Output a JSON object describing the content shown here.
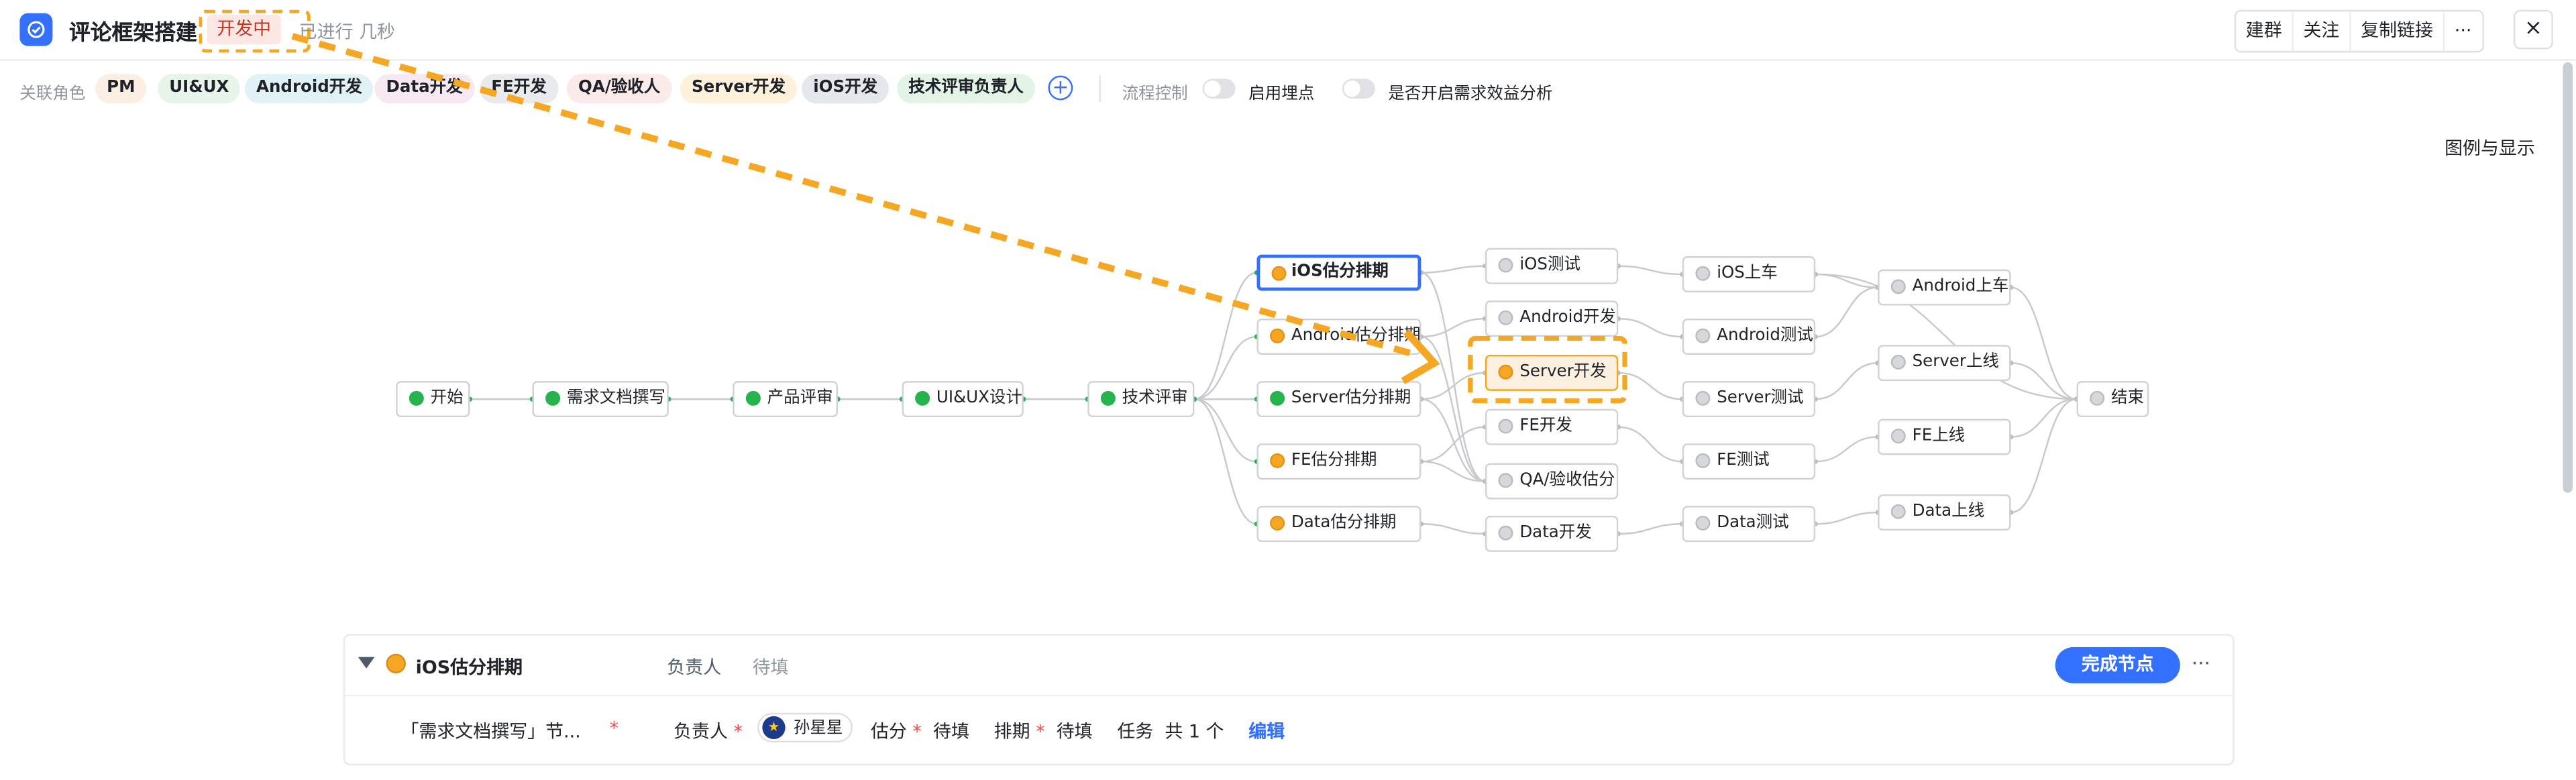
{
  "header": {
    "title": "评论框架搭建",
    "status": "开发中",
    "elapsed": "已进行 几秒",
    "actions": [
      "建群",
      "关注",
      "复制链接",
      "···"
    ],
    "close": "×"
  },
  "roles_bar": {
    "label": "关联角色",
    "roles": [
      {
        "label": "PM",
        "bg": "#fbeee2",
        "fg": "#1f2329"
      },
      {
        "label": "UI&UX",
        "bg": "#e6f4ea",
        "fg": "#1f2329"
      },
      {
        "label": "Android开发",
        "bg": "#e1f2f7",
        "fg": "#1f2329"
      },
      {
        "label": "Data开发",
        "bg": "#f6e9f2",
        "fg": "#1f2329"
      },
      {
        "label": "FE开发",
        "bg": "#e9eaec",
        "fg": "#1f2329"
      },
      {
        "label": "QA/验收人",
        "bg": "#fbeaea",
        "fg": "#1f2329"
      },
      {
        "label": "Server开发",
        "bg": "#fdf1dc",
        "fg": "#1f2329"
      },
      {
        "label": "iOS开发",
        "bg": "#e4e7eb",
        "fg": "#1f2329"
      },
      {
        "label": "技术评审负责人",
        "bg": "#e3f3e6",
        "fg": "#1f2329"
      }
    ],
    "add": "+",
    "flow_control": "流程控制",
    "toggle_tracking": "启用埋点",
    "toggle_benefit": "是否开启需求效益分析"
  },
  "legend_link": "图例与显示",
  "graph": {
    "nodes": [
      {
        "id": "start",
        "label": "开始",
        "status": "green"
      },
      {
        "id": "prd",
        "label": "需求文档撰写",
        "status": "green"
      },
      {
        "id": "review",
        "label": "产品评审",
        "status": "green"
      },
      {
        "id": "design",
        "label": "UI&UX设计",
        "status": "green"
      },
      {
        "id": "tech",
        "label": "技术评审",
        "status": "green"
      },
      {
        "id": "ios_est",
        "label": "iOS估分排期",
        "status": "orange"
      },
      {
        "id": "android_est",
        "label": "Android估分排期",
        "status": "orange"
      },
      {
        "id": "server_est",
        "label": "Server估分排期",
        "status": "green"
      },
      {
        "id": "fe_est",
        "label": "FE估分排期",
        "status": "orange"
      },
      {
        "id": "data_est",
        "label": "Data估分排期",
        "status": "orange"
      },
      {
        "id": "ios_test",
        "label": "iOS测试",
        "status": "gray"
      },
      {
        "id": "android_dev",
        "label": "Android开发",
        "status": "gray"
      },
      {
        "id": "server_dev",
        "label": "Server开发",
        "status": "orange"
      },
      {
        "id": "fe_dev",
        "label": "FE开发",
        "status": "gray"
      },
      {
        "id": "qa_est",
        "label": "QA/验收估分",
        "status": "gray"
      },
      {
        "id": "data_dev",
        "label": "Data开发",
        "status": "gray"
      },
      {
        "id": "ios_launch",
        "label": "iOS上车",
        "status": "gray"
      },
      {
        "id": "android_test",
        "label": "Android测试",
        "status": "gray"
      },
      {
        "id": "server_test",
        "label": "Server测试",
        "status": "gray"
      },
      {
        "id": "fe_test",
        "label": "FE测试",
        "status": "gray"
      },
      {
        "id": "data_test",
        "label": "Data测试",
        "status": "gray"
      },
      {
        "id": "android_launch",
        "label": "Android上车",
        "status": "gray"
      },
      {
        "id": "server_launch",
        "label": "Server上线",
        "status": "gray"
      },
      {
        "id": "fe_launch",
        "label": "FE上线",
        "status": "gray"
      },
      {
        "id": "data_launch",
        "label": "Data上线",
        "status": "gray"
      },
      {
        "id": "end",
        "label": "结束",
        "status": "gray"
      }
    ]
  },
  "panel": {
    "node_title": "iOS估分排期",
    "owner_label": "负责人",
    "owner_value": "待填",
    "complete_button": "完成节点",
    "more": "···",
    "dependency": "「需求文档撰写」节...",
    "required_mark": "*",
    "owner_field": "负责人",
    "assignee": "孙星星",
    "estimate_label": "估分",
    "estimate_value": "待填",
    "schedule_label": "排期",
    "schedule_value": "待填",
    "task_label": "任务",
    "task_count": "共 1 个",
    "edit": "编辑"
  },
  "colors": {
    "accent": "#3370ff",
    "done": "#26b34d",
    "in_progress": "#f5a623",
    "pending": "#d6d8db",
    "annotation": "#f5a623"
  }
}
